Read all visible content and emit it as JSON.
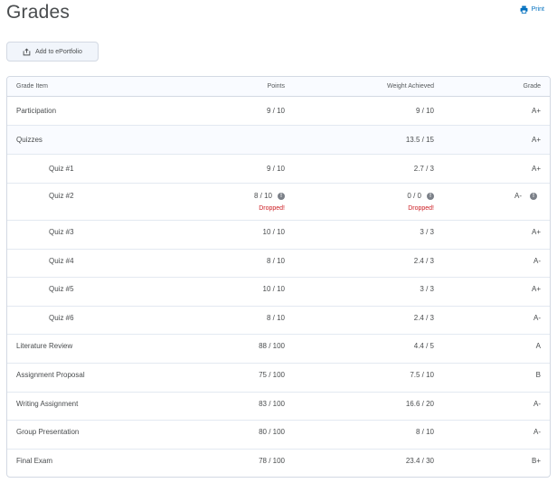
{
  "page": {
    "title": "Grades"
  },
  "toolbar": {
    "print_label": "Print",
    "print_icon": "printer-icon",
    "eportfolio_label": "Add to ePortfolio",
    "eportfolio_icon": "share-export-icon"
  },
  "colors": {
    "link": "#006fbf",
    "dropped": "#cd2026",
    "header_bg": "#f9fbff",
    "border": "#d3d9e3"
  },
  "table": {
    "headers": {
      "item": "Grade Item",
      "points": "Points",
      "weight": "Weight Achieved",
      "grade": "Grade"
    },
    "rows": [
      {
        "name": "Participation",
        "points": "9 / 10",
        "weight": "9 / 10",
        "grade": "A+"
      },
      {
        "name": "Quizzes",
        "points": "",
        "weight": "13.5 / 15",
        "grade": "A+"
      },
      {
        "name": "Quiz #1",
        "points": "9 / 10",
        "weight": "2.7 / 3",
        "grade": "A+"
      },
      {
        "name": "Quiz #2",
        "points": "8 / 10",
        "weight": "0 / 0",
        "grade": "A-",
        "points_note": "Dropped!",
        "weight_note": "Dropped!",
        "info_icon": "info-icon"
      },
      {
        "name": "Quiz #3",
        "points": "10 / 10",
        "weight": "3 / 3",
        "grade": "A+"
      },
      {
        "name": "Quiz #4",
        "points": "8 / 10",
        "weight": "2.4 / 3",
        "grade": "A-"
      },
      {
        "name": "Quiz #5",
        "points": "10 / 10",
        "weight": "3 / 3",
        "grade": "A+"
      },
      {
        "name": "Quiz #6",
        "points": "8 / 10",
        "weight": "2.4 / 3",
        "grade": "A-"
      },
      {
        "name": "Literature Review",
        "points": "88 / 100",
        "weight": "4.4 / 5",
        "grade": "A"
      },
      {
        "name": "Assignment Proposal",
        "points": "75 / 100",
        "weight": "7.5 / 10",
        "grade": "B"
      },
      {
        "name": "Writing Assignment",
        "points": "83 / 100",
        "weight": "16.6 / 20",
        "grade": "A-"
      },
      {
        "name": "Group Presentation",
        "points": "80 / 100",
        "weight": "8 / 10",
        "grade": "A-"
      },
      {
        "name": "Final Exam",
        "points": "78 / 100",
        "weight": "23.4 / 30",
        "grade": "B+"
      }
    ]
  }
}
